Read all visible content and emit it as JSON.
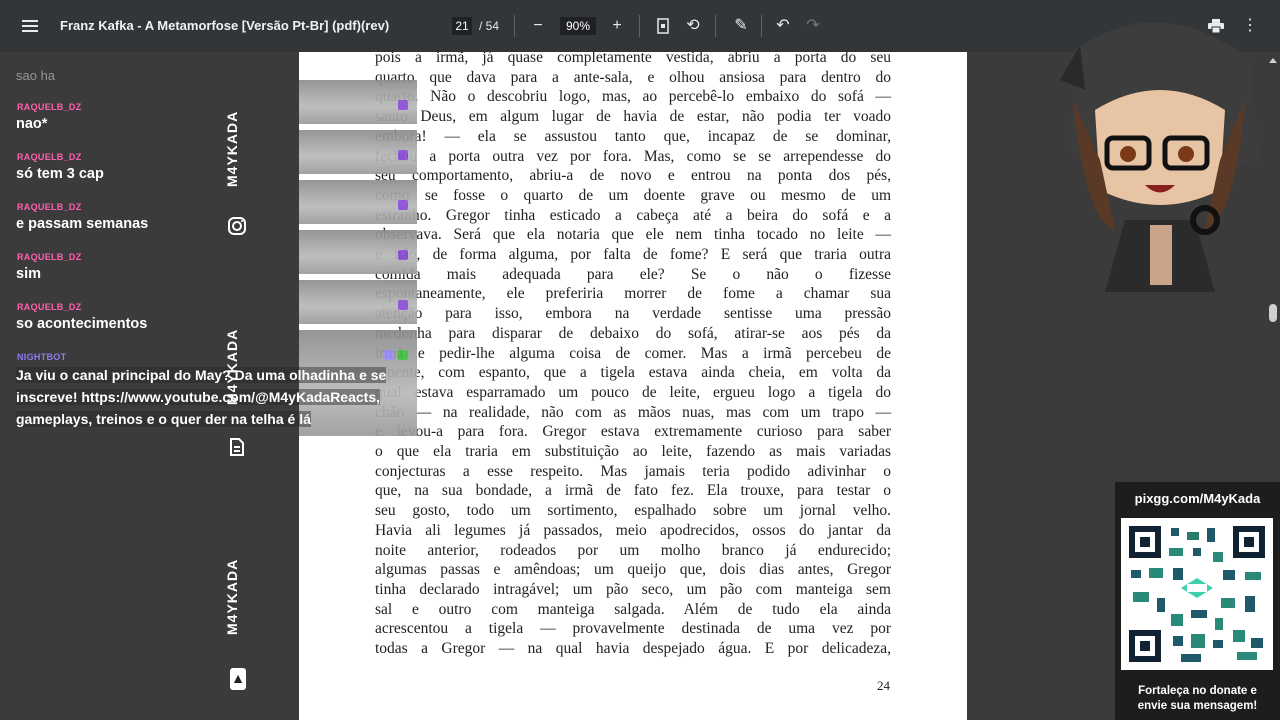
{
  "toolbar": {
    "title": "Franz Kafka - A Metamorfose [Versão Pt-Br] (pdf)(rev)",
    "page_current": "21",
    "page_total": "/ 54",
    "zoom": "90%",
    "icons": [
      "menu-icon",
      "zoom-out-icon",
      "zoom-in-icon",
      "fit-page-icon",
      "rotate-icon",
      "annotate-icon",
      "undo-icon",
      "redo-icon",
      "print-icon",
      "more-icon"
    ]
  },
  "chat": {
    "cut_text": "sao ha",
    "messages": [
      {
        "user": "RAQUELB_DZ",
        "text": "nao*",
        "color": "#ff5fb0"
      },
      {
        "user": "RAQUELB_DZ",
        "text": "só tem 3 cap",
        "color": "#ff5fb0"
      },
      {
        "user": "RAQUELB_DZ",
        "text": "e passam semanas",
        "color": "#ff5fb0"
      },
      {
        "user": "RAQUELB_DZ",
        "text": "sim",
        "color": "#ff5fb0"
      },
      {
        "user": "RAQUELB_DZ",
        "text": "so acontecimentos",
        "color": "#ff5fb0"
      },
      {
        "user": "NIGHTBOT",
        "text": "Ja viu o canal principal do May? Da uma olhadinha e se inscreve! https://www.youtube.com/@M4yKadaReacts, gameplays, treinos e o quer der na telha é lá",
        "color": "#8c7cf0"
      }
    ],
    "brand": "M4YKADA"
  },
  "pdf": {
    "lines": [
      "pois a irmã, já quase completamente vestida, abriu a porta do seu",
      "quarto que dava para a ante-sala, e olhou ansiosa para dentro do",
      "quarto. Não o descobriu logo, mas, ao percebê-lo embaixo do sofá —",
      "santo Deus, em algum lugar de havia de estar, não podia ter voado",
      "embora! — ela se assustou tanto que, incapaz de se dominar,",
      "fechou a porta outra vez por fora. Mas, como se se arrependesse do",
      "seu comportamento, abriu-a de novo e entrou na ponta dos pés,",
      "como se fosse o quarto de um doente grave ou mesmo de um",
      "estranho. Gregor tinha esticado a cabeça até a beira do sofá e a",
      "observava. Será que ela notaria que ele nem tinha tocado no leite —",
      "e não, de forma alguma, por falta de fome? E será que traria outra",
      "comida mais adequada para ele? Se o não o fizesse",
      "espontaneamente, ele preferiria morrer de fome a chamar sua",
      "atenção para isso, embora na verdade sentisse uma pressão",
      "medonha para disparar de debaixo do sofá, atirar-se aos pés da",
      "irmã e pedir-lhe alguma coisa de comer. Mas a irmã percebeu de",
      "repente, com espanto, que a tigela estava ainda cheia, em volta da",
      "qual estava esparramado um pouco de leite, ergueu logo a tigela do",
      "chão — na realidade, não com as mãos nuas, mas com um trapo —",
      "e levou-a para fora. Gregor estava extremamente curioso para saber",
      "o que ela traria em substituição ao leite, fazendo as mais variadas",
      "conjecturas a esse respeito. Mas jamais teria podido adivinhar o",
      "que, na sua bondade, a irmã de fato fez. Ela trouxe, para testar o",
      "seu gosto, todo um sortimento, espalhado sobre um jornal velho.",
      "Havia ali legumes já passados, meio apodrecidos, ossos do jantar da",
      "noite anterior, rodeados por um molho branco já endurecido;",
      "algumas passas e amêndoas; um queijo que, dois dias antes, Gregor",
      "tinha declarado intragável; um pão seco, um pão com manteiga sem",
      "sal e outro com manteiga salgada. Além de tudo ela ainda",
      "acrescentou a tigela — provavelmente destinada de uma vez por",
      "todas a Gregor — na qual havia despejado água. E por delicadeza,"
    ],
    "page_number": "24"
  },
  "donation": {
    "url": "pixgg.com/M4yKada",
    "caption_line1": "Fortaleça no donate e",
    "caption_line2": "envie sua mensagem!"
  }
}
